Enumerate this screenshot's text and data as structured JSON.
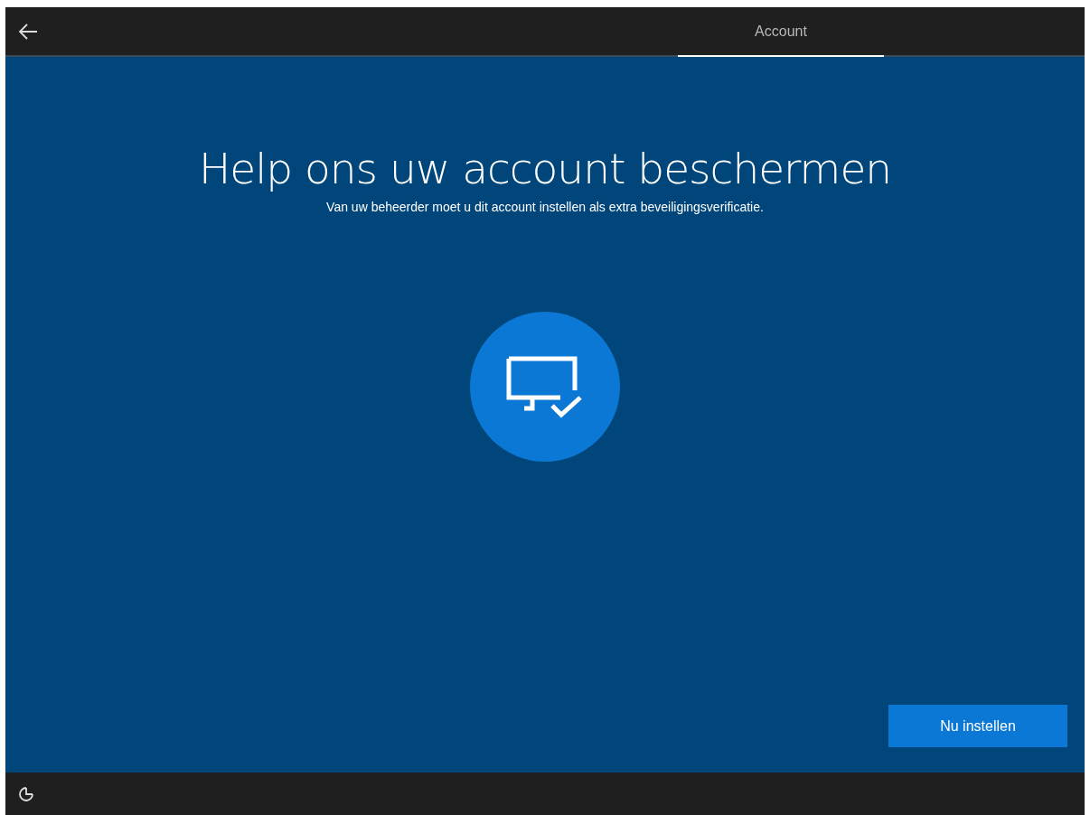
{
  "top_bar": {
    "tabs": [
      {
        "label": "Account",
        "selected": true
      }
    ]
  },
  "main": {
    "title": "Help ons uw account beschermen",
    "subtitle": "Van uw beheerder moet u dit account instellen als extra beveiligingsverificatie."
  },
  "buttons": [
    {
      "label": "Nu instellen"
    }
  ]
}
